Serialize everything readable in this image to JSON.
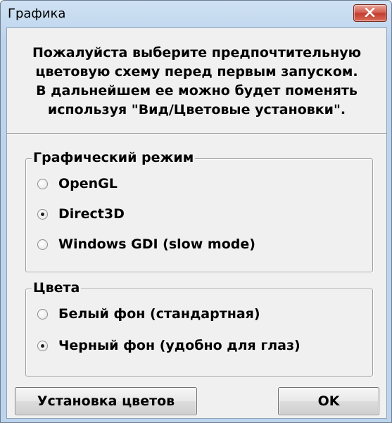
{
  "window": {
    "title": "Графика"
  },
  "intro": {
    "lines": [
      "Пожалуйста выберите предпочтительную",
      "цветовую схему перед первым запуском.",
      "В дальнейшем ее можно будет поменять",
      "используя \"Вид/Цветовые установки\"."
    ]
  },
  "graphics_mode": {
    "legend": "Графический режим",
    "options": [
      {
        "label": "OpenGL",
        "checked": false
      },
      {
        "label": "Direct3D",
        "checked": true
      },
      {
        "label": "Windows GDI (slow mode)",
        "checked": false
      }
    ]
  },
  "colors": {
    "legend": "Цвета",
    "options": [
      {
        "label": "Белый фон (стандартная)",
        "checked": false
      },
      {
        "label": "Черный фон (удобно для глаз)",
        "checked": true
      }
    ]
  },
  "buttons": {
    "color_settings": "Установка цветов",
    "ok": "OK"
  },
  "icons": {
    "close": "close-icon"
  },
  "theme": {
    "close_button": "#c8463a",
    "dialog_background": "#f0f0f0",
    "frame": "#bcd4ec"
  }
}
